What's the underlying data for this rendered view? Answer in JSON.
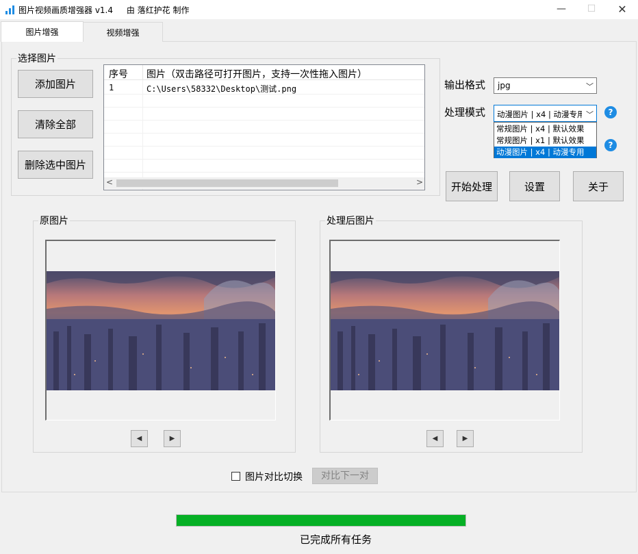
{
  "window": {
    "title": "图片视频画质增强器 v1.4",
    "author": "由 落红护花 制作",
    "minimize_glyph": "—",
    "maximize_glyph": "☐",
    "close_glyph": "✕"
  },
  "tabs": [
    {
      "label": "图片增强",
      "active": true
    },
    {
      "label": "视频增强",
      "active": false
    }
  ],
  "select_group": {
    "label": "选择图片",
    "add_button": "添加图片",
    "clear_button": "清除全部",
    "delete_button": "删除选中图片"
  },
  "list": {
    "columns": [
      "序号",
      "图片（双击路径可打开图片，支持一次性拖入图片）"
    ],
    "rows": [
      {
        "index": "1",
        "path": "C:\\Users\\58332\\Desktop\\测试.png"
      }
    ],
    "scroll_left": "<",
    "scroll_right": ">"
  },
  "settings": {
    "output_format_label": "输出格式",
    "output_format_value": "jpg",
    "mode_label": "处理模式",
    "mode_value": "动漫图片 | x4 | 动漫专用",
    "mode_options": [
      "常规图片 | x4 | 默认效果",
      "常规图片 | x1 | 默认效果",
      "动漫图片 | x4 | 动漫专用"
    ],
    "selected_option_index": 2,
    "help_glyph": "?"
  },
  "actions": {
    "start": "开始处理",
    "settings": "设置",
    "about": "关于"
  },
  "original": {
    "label": "原图片",
    "prev": "◀",
    "next": "▶"
  },
  "processed": {
    "label": "处理后图片",
    "prev": "◀",
    "next": "▶"
  },
  "compare": {
    "checkbox_label": "图片对比切换",
    "checked": false,
    "next_pair_button": "对比下一对"
  },
  "status": {
    "progress": 1.0,
    "progress_color": "#06b025",
    "message": "已完成所有任务"
  },
  "colors": {
    "accent": "#1e8ce3",
    "selection": "#0078d7"
  }
}
